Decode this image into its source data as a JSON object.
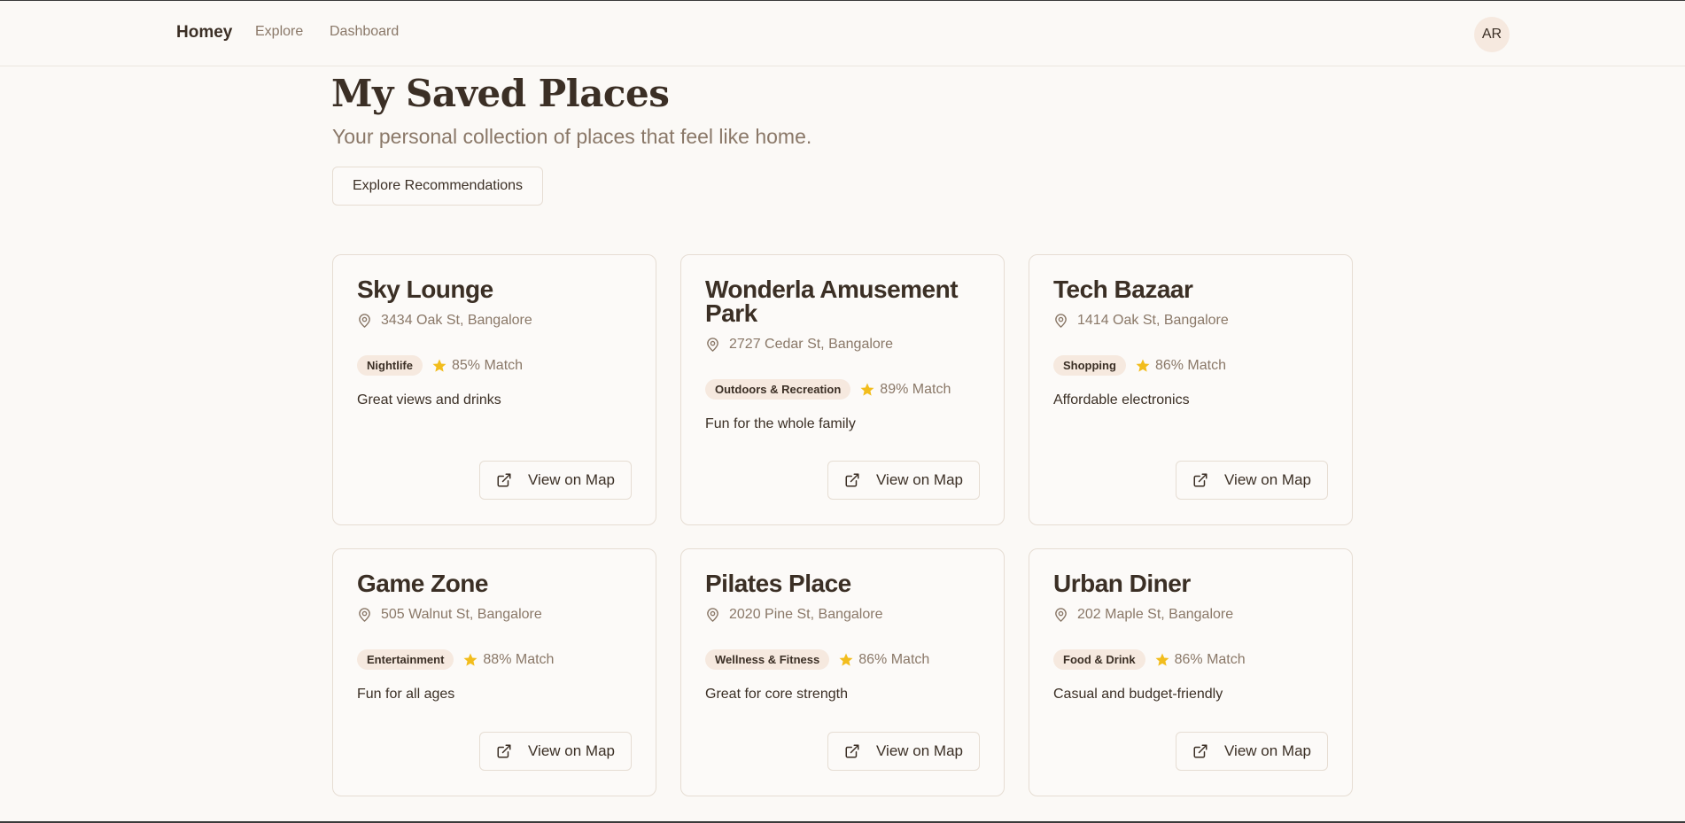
{
  "nav": {
    "brand": "Homey",
    "links": [
      "Explore",
      "Dashboard"
    ],
    "avatar_initials": "AR"
  },
  "header": {
    "title": "My Saved Places",
    "subtitle": "Your personal collection of places that feel like home.",
    "explore_button": "Explore Recommendations"
  },
  "places": [
    {
      "name": "Sky Lounge",
      "address": "3434 Oak St, Bangalore",
      "category": "Nightlife",
      "match": "85% Match",
      "description": "Great views and drinks",
      "map_button": "View on Map"
    },
    {
      "name": "Wonderla Amusement Park",
      "address": "2727 Cedar St, Bangalore",
      "category": "Outdoors & Recreation",
      "match": "89% Match",
      "description": "Fun for the whole family",
      "map_button": "View on Map"
    },
    {
      "name": "Tech Bazaar",
      "address": "1414 Oak St, Bangalore",
      "category": "Shopping",
      "match": "86% Match",
      "description": "Affordable electronics",
      "map_button": "View on Map"
    },
    {
      "name": "Game Zone",
      "address": "505 Walnut St, Bangalore",
      "category": "Entertainment",
      "match": "88% Match",
      "description": "Fun for all ages",
      "map_button": "View on Map"
    },
    {
      "name": "Pilates Place",
      "address": "2020 Pine St, Bangalore",
      "category": "Wellness & Fitness",
      "match": "86% Match",
      "description": "Great for core strength",
      "map_button": "View on Map"
    },
    {
      "name": "Urban Diner",
      "address": "202 Maple St, Bangalore",
      "category": "Food & Drink",
      "match": "86% Match",
      "description": "Casual and budget-friendly",
      "map_button": "View on Map"
    }
  ],
  "colors": {
    "background": "#fbf9f6",
    "text": "#3b2f25",
    "muted": "#8a7868",
    "tag_bg": "#f6e9df",
    "star": "#f2bd1d"
  },
  "icons": {
    "address": "map-pin-icon",
    "match": "star-icon",
    "map_button": "external-link-icon"
  }
}
